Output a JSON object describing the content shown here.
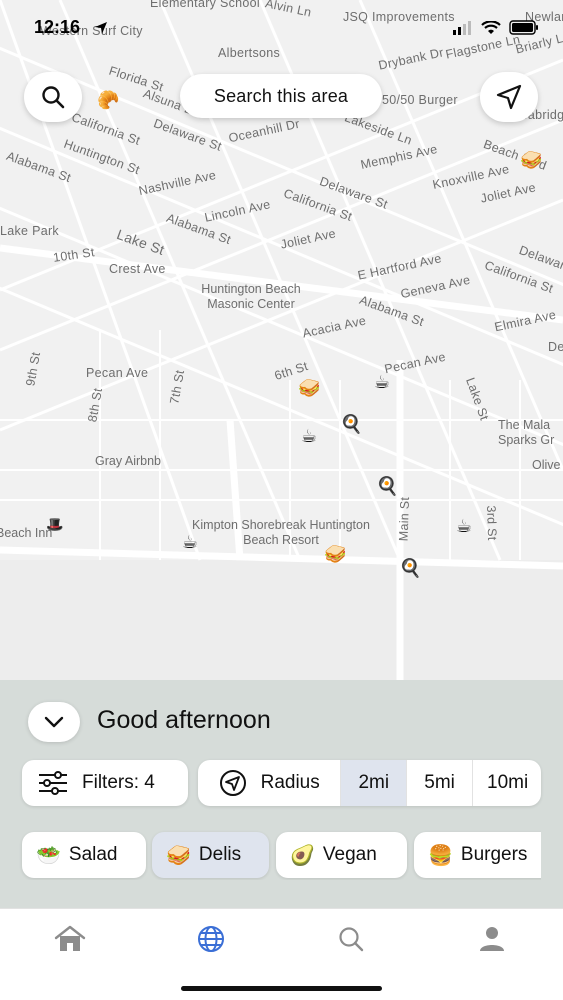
{
  "status_bar": {
    "time": "12:16"
  },
  "map": {
    "search_area_label": "Search this area",
    "streets": [
      "Elementary School",
      "Alvin Ln",
      "Western Surf City",
      "JSQ Improvements",
      "Newland P",
      "Albertsons",
      "Drybank Dr",
      "Flagstone Ln",
      "Briarly Ln",
      "Florida St",
      "Alsuna Ln",
      "50/50 Burger",
      "California St",
      "Delaware St",
      "Oceanhill Dr",
      "Lakeside Ln",
      "Seabridge Co",
      "Huntington St",
      "Memphis Ave",
      "Beach Blvd",
      "Alabama St",
      "Nashville Ave",
      "Knoxville Ave",
      "Delaware St",
      "Joliet Ave",
      "California St",
      "Lincoln Ave",
      "Alabama St",
      "Joliet Ave",
      "Lake Park",
      "Lake St",
      "10th St",
      "Crest Ave",
      "E Hartford Ave",
      "Delaware",
      "Geneva Ave",
      "California St",
      "Alabama St",
      "Acacia Ave",
      "Elmira Ave",
      "9th St",
      "Pecan Ave",
      "8th St",
      "7th St",
      "6th St",
      "Pecan Ave",
      "Lake St",
      "Main St",
      "3rd St",
      "De"
    ],
    "pois": [
      "Huntington Beach Masonic Center",
      "The Mala Sparks Gr",
      "Olive",
      "Gray Airbnb",
      "Beach Inn",
      "Kimpton Shorebreak Huntington Beach Resort"
    ]
  },
  "greeting": "Good afternoon",
  "filters": {
    "label": "Filters: 4"
  },
  "radius": {
    "label": "Radius",
    "options": [
      "2mi",
      "5mi",
      "10mi"
    ],
    "selected": "2mi"
  },
  "categories": [
    {
      "emoji": "🥗",
      "label": "Salad"
    },
    {
      "emoji": "🥪",
      "label": "Delis",
      "selected": true
    },
    {
      "emoji": "🥑",
      "label": "Vegan"
    },
    {
      "emoji": "🍔",
      "label": "Burgers"
    }
  ],
  "tabs": [
    "home",
    "explore",
    "search",
    "profile"
  ],
  "colors": {
    "accent": "#3b6fd6",
    "sheet": "#d6dcd9",
    "selected": "#dfe4ee"
  }
}
